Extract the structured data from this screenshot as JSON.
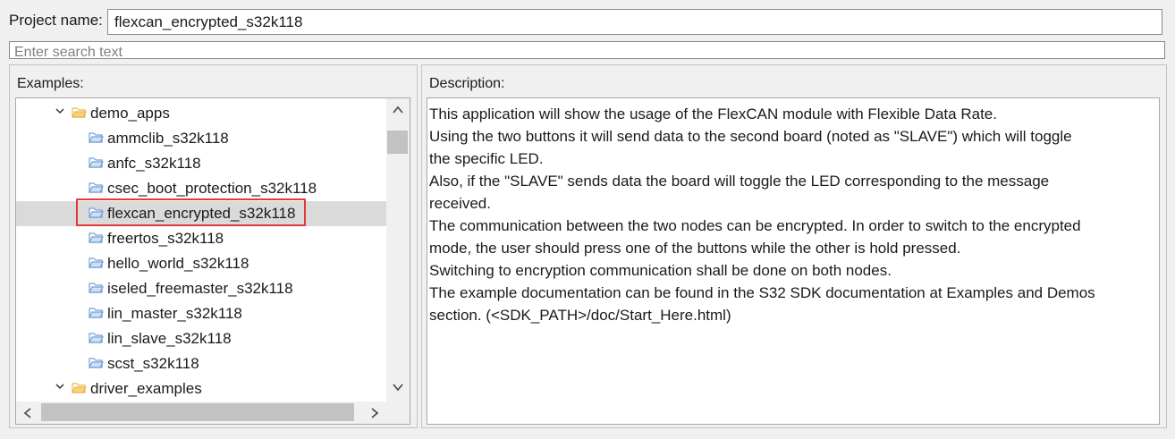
{
  "project": {
    "label": "Project name:",
    "value": "flexcan_encrypted_s32k118"
  },
  "search": {
    "placeholder": "Enter search text"
  },
  "examples": {
    "label": "Examples:",
    "tree": [
      {
        "label": "demo_apps",
        "type": "folder",
        "expanded": true,
        "level": 0
      },
      {
        "label": "ammclib_s32k118",
        "type": "item",
        "level": 1
      },
      {
        "label": "anfc_s32k118",
        "type": "item",
        "level": 1
      },
      {
        "label": "csec_boot_protection_s32k118",
        "type": "item",
        "level": 1
      },
      {
        "label": "flexcan_encrypted_s32k118",
        "type": "item",
        "level": 1,
        "selected": true
      },
      {
        "label": "freertos_s32k118",
        "type": "item",
        "level": 1
      },
      {
        "label": "hello_world_s32k118",
        "type": "item",
        "level": 1
      },
      {
        "label": "iseled_freemaster_s32k118",
        "type": "item",
        "level": 1
      },
      {
        "label": "lin_master_s32k118",
        "type": "item",
        "level": 1
      },
      {
        "label": "lin_slave_s32k118",
        "type": "item",
        "level": 1
      },
      {
        "label": "scst_s32k118",
        "type": "item",
        "level": 1
      },
      {
        "label": "driver_examples",
        "type": "folder",
        "expanded": true,
        "level": 0
      }
    ]
  },
  "description": {
    "label": "Description:",
    "lines": [
      "This application will show the usage of the FlexCAN module with Flexible Data Rate.",
      "Using the two buttons it will send data to the second board (noted as \"SLAVE\") which will toggle",
      "the specific LED.",
      "Also, if the \"SLAVE\" sends data the board will toggle the LED corresponding to the message",
      "received.",
      "The communication between the two nodes can be encrypted. In order to switch to the encrypted",
      "mode, the user should press one of the buttons while the other is hold pressed.",
      "Switching to encryption communication shall be done on both nodes.",
      "The example documentation can be found in the S32 SDK documentation at Examples and Demos",
      "section. (<SDK_PATH>/doc/Start_Here.html)"
    ]
  },
  "colors": {
    "highlight": "#e03a3a",
    "selected_row": "#dadada",
    "folder": "#e8b84a",
    "item_folder": "#6fa0d8"
  }
}
